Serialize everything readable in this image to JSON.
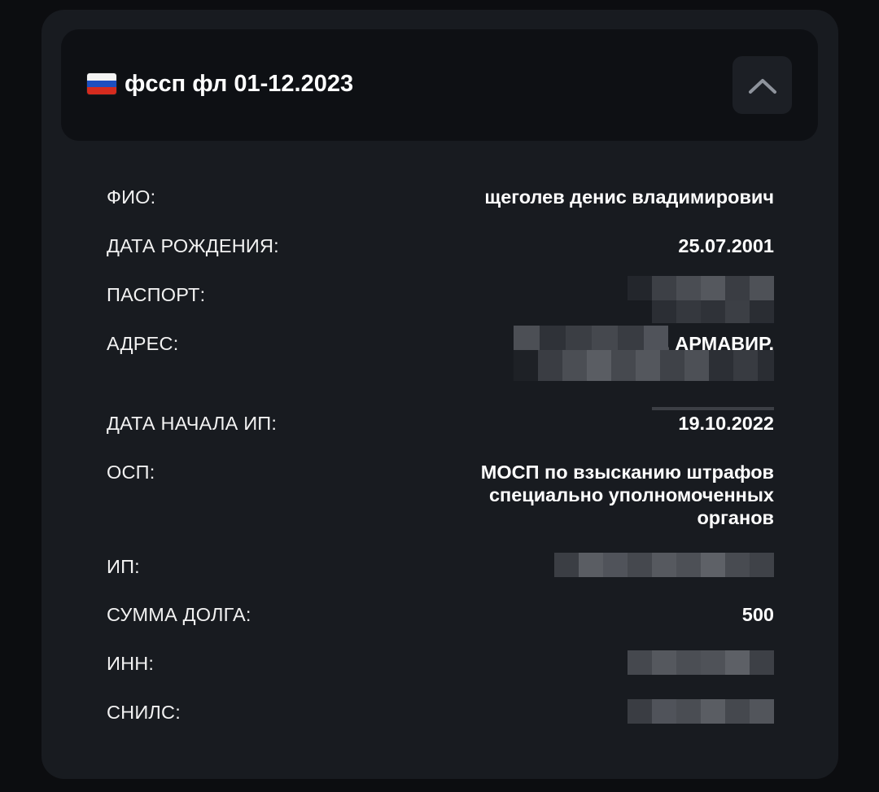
{
  "header": {
    "title": "фссп фл 01-12.2023"
  },
  "fields": {
    "fio": {
      "label": "ФИО:",
      "value": "щеголев денис владимирович"
    },
    "birth": {
      "label": "ДАТА РОЖДЕНИЯ:",
      "value": "25.07.2001"
    },
    "passport": {
      "label": "ПАСПОРТ:"
    },
    "address": {
      "label": "АДРЕС:",
      "value": ", АРМАВИР,"
    },
    "ip_start": {
      "label": "ДАТА НАЧАЛА ИП:",
      "value": "19.10.2022"
    },
    "osp": {
      "label": "ОСП:",
      "line1": "МОСП по взысканию штрафов",
      "line2": "специально уполномоченных",
      "line3": "органов"
    },
    "ip": {
      "label": "ИП:"
    },
    "debt": {
      "label": "СУММА ДОЛГА:",
      "value": "500"
    },
    "inn": {
      "label": "ИНН:"
    },
    "snils": {
      "label": "СНИЛС:"
    }
  },
  "colors": {
    "background": "#0c0d10",
    "card": "#181b20",
    "header": "#0e1014",
    "text": "#ffffff"
  }
}
